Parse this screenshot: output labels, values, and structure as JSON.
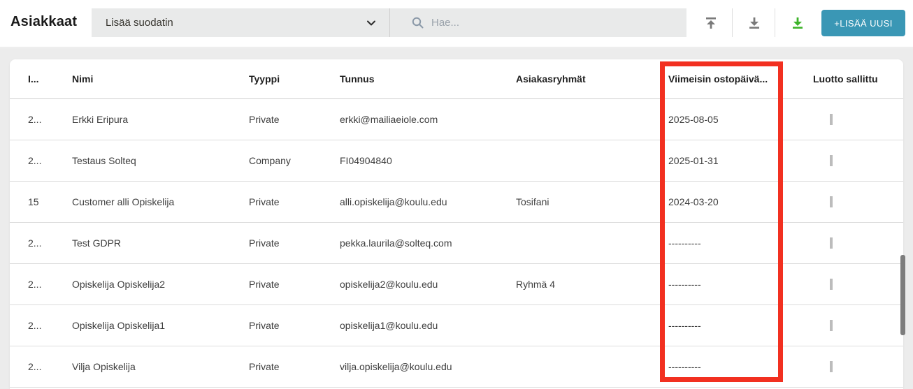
{
  "header": {
    "title": "Asiakkaat",
    "filter_dropdown": {
      "label": "Lisää suodatin",
      "icon": "chevron-down"
    },
    "search": {
      "placeholder": "Hae...",
      "icon": "magnifier"
    },
    "actions": {
      "upload_icon": "upload-arrow",
      "download_icon": "download-arrow",
      "export_icon": "download-arrow-green",
      "add_button_label": "+LISÄÄ UUSI"
    },
    "colors": {
      "add_button": "#3a97b5",
      "export_icon_green": "#3db32a",
      "gray_icon": "#7a7a7a"
    }
  },
  "table": {
    "columns": {
      "id": "I...",
      "nimi": "Nimi",
      "tyyppi": "Tyyppi",
      "tunnus": "Tunnus",
      "asiakasryhmat": "Asiakasryhmät",
      "viimeisin": "Viimeisin ostopäivä...",
      "luotto": "Luotto sallittu"
    },
    "rows": [
      {
        "id": "2...",
        "nimi": "Erkki Eripura",
        "tyyppi": "Private",
        "tunnus": "erkki@mailiaeiole.com",
        "asiakasryhmat": "",
        "viimeisin": "2025-08-05",
        "luotto_checked": false
      },
      {
        "id": "2...",
        "nimi": "Testaus Solteq",
        "tyyppi": "Company",
        "tunnus": "FI04904840",
        "asiakasryhmat": "",
        "viimeisin": "2025-01-31",
        "luotto_checked": false
      },
      {
        "id": "15",
        "nimi": "Customer alli Opiskelija",
        "tyyppi": "Private",
        "tunnus": "alli.opiskelija@koulu.edu",
        "asiakasryhmat": "Tosifani",
        "viimeisin": "2024-03-20",
        "luotto_checked": false
      },
      {
        "id": "2...",
        "nimi": "Test GDPR",
        "tyyppi": "Private",
        "tunnus": "pekka.laurila@solteq.com",
        "asiakasryhmat": "",
        "viimeisin": "----------",
        "luotto_checked": false
      },
      {
        "id": "2...",
        "nimi": "Opiskelija Opiskelija2",
        "tyyppi": "Private",
        "tunnus": "opiskelija2@koulu.edu",
        "asiakasryhmat": "Ryhmä 4",
        "viimeisin": "----------",
        "luotto_checked": false
      },
      {
        "id": "2...",
        "nimi": "Opiskelija Opiskelija1",
        "tyyppi": "Private",
        "tunnus": "opiskelija1@koulu.edu",
        "asiakasryhmat": "",
        "viimeisin": "----------",
        "luotto_checked": false
      },
      {
        "id": "2...",
        "nimi": "Vilja Opiskelija",
        "tyyppi": "Private",
        "tunnus": "vilja.opiskelija@koulu.edu",
        "asiakasryhmat": "",
        "viimeisin": "----------",
        "luotto_checked": false
      }
    ]
  },
  "annotation": {
    "highlighted_column": "Viimeisin ostopäivä...",
    "color": "#f23020"
  }
}
